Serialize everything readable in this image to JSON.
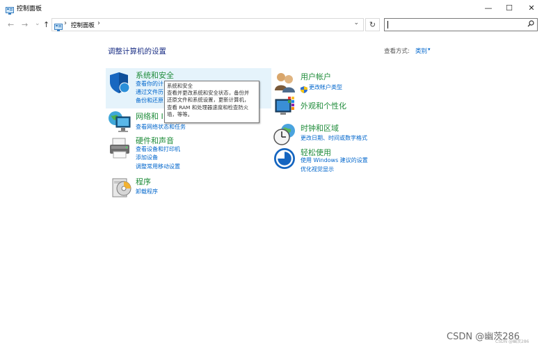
{
  "window": {
    "title": "控制面板",
    "controls": {
      "minimize": "—",
      "maximize": "☐",
      "close": "✕"
    }
  },
  "address": {
    "nav_back": "←",
    "nav_forward": "→",
    "nav_recent": "⌄",
    "nav_up": "↑",
    "separator": "›",
    "path": "控制面板",
    "dropdown": "⌄",
    "refresh": "↻",
    "search_value": ""
  },
  "page": {
    "title": "调整计算机的设置",
    "view_by_label": "查看方式:",
    "view_by_value": "类别",
    "view_by_arrow": "▾"
  },
  "categories_left": [
    {
      "name": "system-security",
      "title": "系统和安全",
      "links": [
        "查看你的计",
        "通过文件历",
        "备份和还原"
      ]
    },
    {
      "name": "network-internet",
      "title": "网络和 I",
      "links": [
        "查看网络状态和任务"
      ]
    },
    {
      "name": "hardware-sound",
      "title": "硬件和声音",
      "links": [
        "查看设备和打印机",
        "添加设备",
        "调整常用移动设置"
      ]
    },
    {
      "name": "programs",
      "title": "程序",
      "links": [
        "卸载程序"
      ]
    }
  ],
  "categories_right": [
    {
      "name": "user-accounts",
      "title": "用户帐户",
      "links": [
        "更改帐户类型"
      ]
    },
    {
      "name": "appearance",
      "title": "外观和个性化",
      "links": []
    },
    {
      "name": "clock-region",
      "title": "时钟和区域",
      "links": [
        "更改日期、时间或数字格式"
      ]
    },
    {
      "name": "ease-of-access",
      "title": "轻松使用",
      "links": [
        "使用 Windows 建议的设置",
        "优化视觉显示"
      ]
    }
  ],
  "tooltip": {
    "lines": [
      "系统和安全",
      "查看并更改系统和安全状态，备份并",
      "还原文件和系统设置，更新计算机，",
      "查看 RAM 和处理器速度和检查防火",
      "墙，等等。"
    ]
  },
  "watermark": {
    "text": "CSDN @幽茨286",
    "small": "CSDN @幽茨286"
  },
  "colors": {
    "title_blue": "#1e3287",
    "category_green": "#1f8c3a",
    "link_blue": "#0066cc",
    "highlight": "#e5f3fb",
    "desktop": "#1e5f3c"
  }
}
